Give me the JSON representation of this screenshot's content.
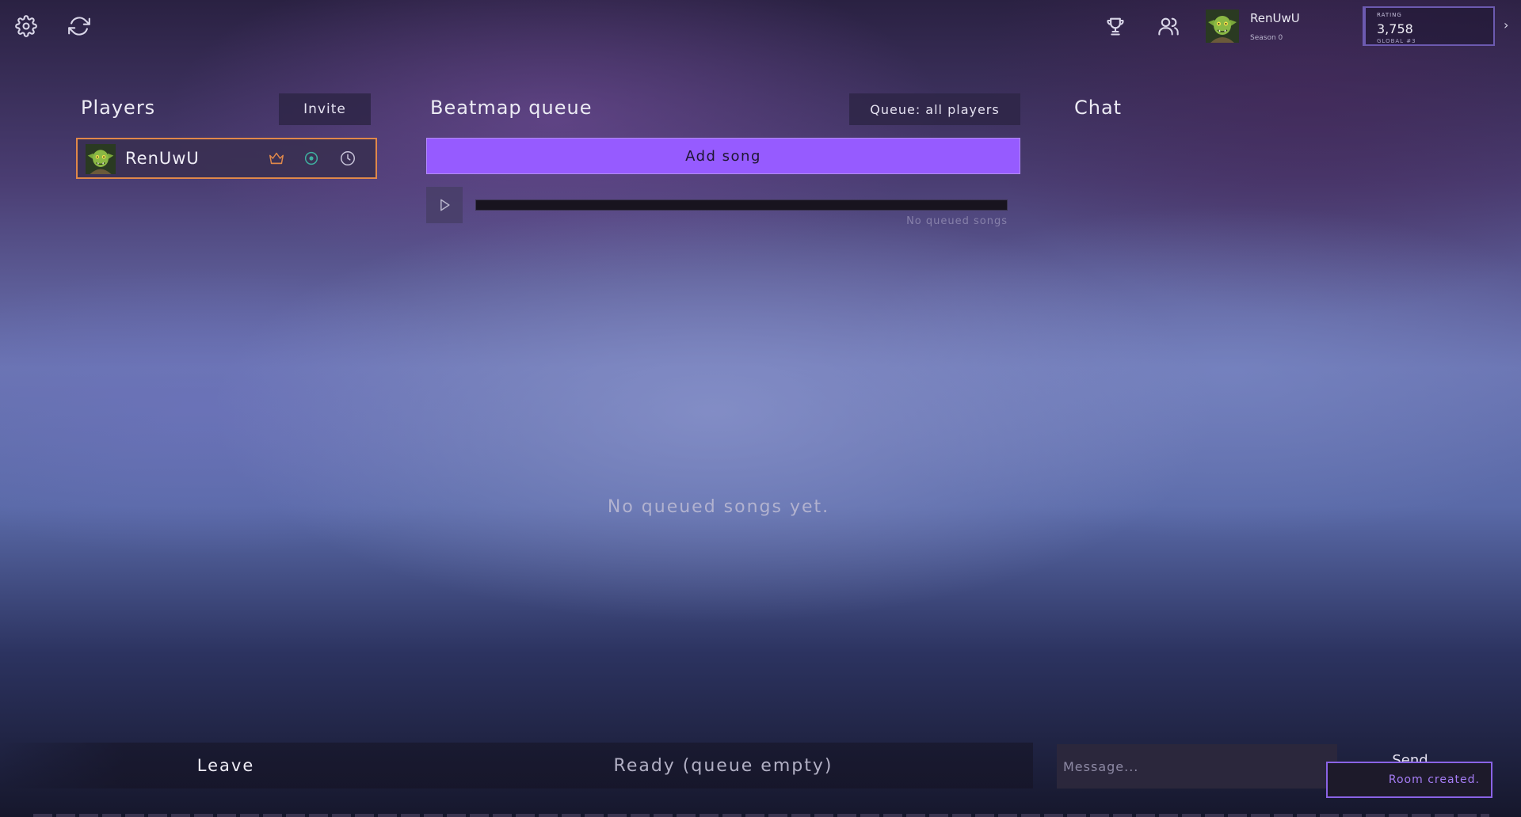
{
  "topbar": {
    "settings_icon": "gear-icon",
    "refresh_icon": "refresh-icon",
    "trophy_icon": "trophy-icon",
    "friends_icon": "users-icon",
    "profile": {
      "name": "RenUwU",
      "season": "Season 0"
    },
    "rating": {
      "label": "RATING",
      "value": "3,758",
      "global": "GLOBAL #3"
    },
    "expand_icon": "chevron-right-icon"
  },
  "players": {
    "title": "Players",
    "invite_label": "Invite",
    "list": [
      {
        "name": "RenUwU",
        "icons": [
          "crown-icon",
          "target-icon",
          "clock-icon"
        ]
      }
    ]
  },
  "queue": {
    "title": "Beatmap queue",
    "mode_label": "Queue: all players",
    "add_label": "Add song",
    "count_label": "No queued songs",
    "empty_message": "No queued songs yet.",
    "progress": 0
  },
  "chat": {
    "title": "Chat",
    "placeholder": "Message...",
    "send_label": "Send"
  },
  "footer": {
    "leave_label": "Leave",
    "ready_label": "Ready (queue empty)"
  },
  "toast": {
    "message": "Room created."
  },
  "colors": {
    "accent": "#965bff",
    "host_border": "#e0884a",
    "crown": "#e0884a",
    "ready_indicator": "#3fb0a0"
  }
}
